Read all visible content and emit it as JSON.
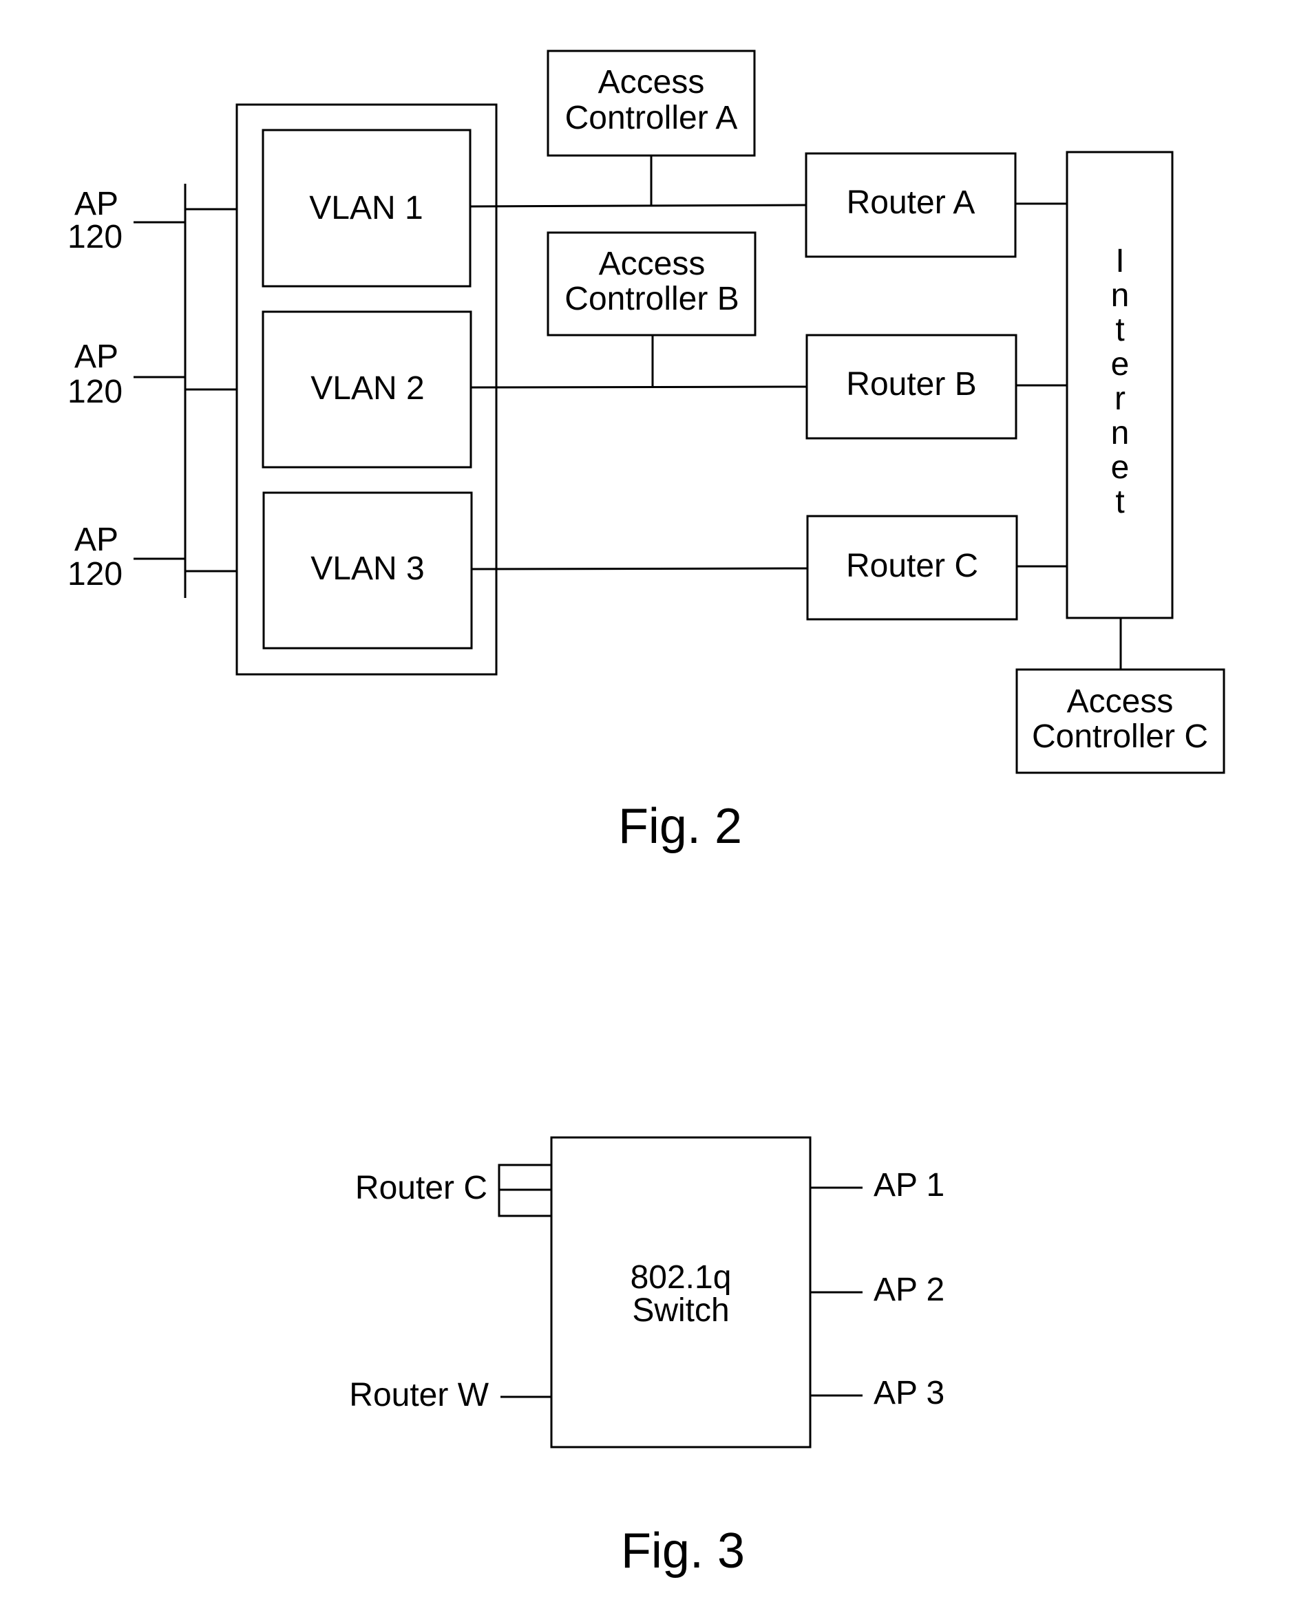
{
  "figure2": {
    "caption": "Fig. 2",
    "access_points": [
      {
        "line1": "AP",
        "line2": "120"
      },
      {
        "line1": "AP",
        "line2": "120"
      },
      {
        "line1": "AP",
        "line2": "120"
      }
    ],
    "vlans": [
      "VLAN 1",
      "VLAN 2",
      "VLAN 3"
    ],
    "access_controllers": [
      {
        "line1": "Access",
        "line2": "Controller A"
      },
      {
        "line1": "Access",
        "line2": "Controller B"
      },
      {
        "line1": "Access",
        "line2": "Controller C"
      }
    ],
    "routers": [
      "Router A",
      "Router B",
      "Router C"
    ],
    "internet_letters": [
      "I",
      "n",
      "t",
      "e",
      "r",
      "n",
      "e",
      "t"
    ]
  },
  "figure3": {
    "caption": "Fig. 3",
    "switch": {
      "line1": "802.1q",
      "line2": "Switch"
    },
    "left_ports": [
      "Router C",
      "Router W"
    ],
    "right_ports": [
      "AP 1",
      "AP 2",
      "AP 3"
    ]
  }
}
